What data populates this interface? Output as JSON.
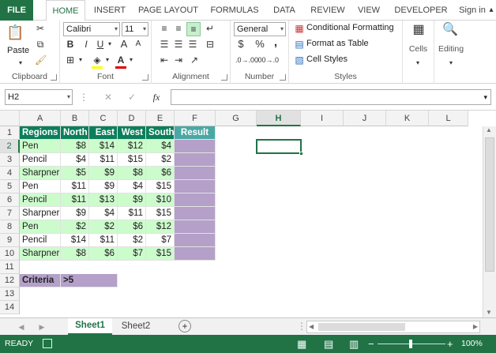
{
  "tabs": {
    "file": "FILE",
    "home": "HOME",
    "insert": "INSERT",
    "page_layout": "PAGE LAYOUT",
    "formulas": "FORMULAS",
    "data": "DATA",
    "review": "REVIEW",
    "view": "VIEW",
    "developer": "DEVELOPER",
    "sign_in": "Sign in"
  },
  "ribbon": {
    "clipboard": {
      "paste": "Paste",
      "label": "Clipboard"
    },
    "font": {
      "name": "Calibri",
      "size": "11",
      "bold": "B",
      "italic": "I",
      "underline": "U",
      "grow": "A",
      "shrink": "A",
      "fill_letter": "",
      "color_letter": "A",
      "label": "Font"
    },
    "alignment": {
      "label": "Alignment"
    },
    "number": {
      "format": "General",
      "currency": "$",
      "percent": "%",
      "comma": ",",
      "label": "Number"
    },
    "styles": {
      "conditional": "Conditional Formatting",
      "table": "Format as Table",
      "cell_styles": "Cell Styles",
      "label": "Styles"
    },
    "cells": {
      "label": "Cells"
    },
    "editing": {
      "label": "Editing"
    }
  },
  "formula_bar": {
    "name_box": "H2",
    "fx": "fx",
    "formula": ""
  },
  "columns": [
    "A",
    "B",
    "C",
    "D",
    "E",
    "F",
    "G",
    "H",
    "I",
    "J",
    "K",
    "L"
  ],
  "selected_column": "H",
  "rows": [
    "1",
    "2",
    "3",
    "4",
    "5",
    "6",
    "7",
    "8",
    "9",
    "10",
    "11",
    "12",
    "13",
    "14"
  ],
  "selected_row": "2",
  "table": {
    "headers": [
      "Regions",
      "North",
      "East",
      "West",
      "South",
      "Result"
    ],
    "data": [
      [
        "Pen",
        "$8",
        "$14",
        "$12",
        "$4"
      ],
      [
        "Pencil",
        "$4",
        "$11",
        "$15",
        "$2"
      ],
      [
        "Sharpner",
        "$5",
        "$9",
        "$8",
        "$6"
      ],
      [
        "Pen",
        "$11",
        "$9",
        "$4",
        "$15"
      ],
      [
        "Pencil",
        "$11",
        "$13",
        "$9",
        "$10"
      ],
      [
        "Sharpner",
        "$9",
        "$4",
        "$11",
        "$15"
      ],
      [
        "Pen",
        "$2",
        "$2",
        "$6",
        "$12"
      ],
      [
        "Pencil",
        "$14",
        "$11",
        "$2",
        "$7"
      ],
      [
        "Sharpner",
        "$8",
        "$6",
        "$7",
        "$15"
      ]
    ]
  },
  "criteria": {
    "label": "Criteria",
    "value": ">5"
  },
  "sheets": {
    "active": "Sheet1",
    "other": "Sheet2"
  },
  "status": {
    "ready": "READY",
    "zoom": "100%"
  },
  "colors": {
    "accent": "#217346",
    "header_green": "#0b7f5b",
    "result_teal": "#4aa8a4",
    "band_green": "#ccfccc",
    "purple": "#b4a0c8"
  }
}
